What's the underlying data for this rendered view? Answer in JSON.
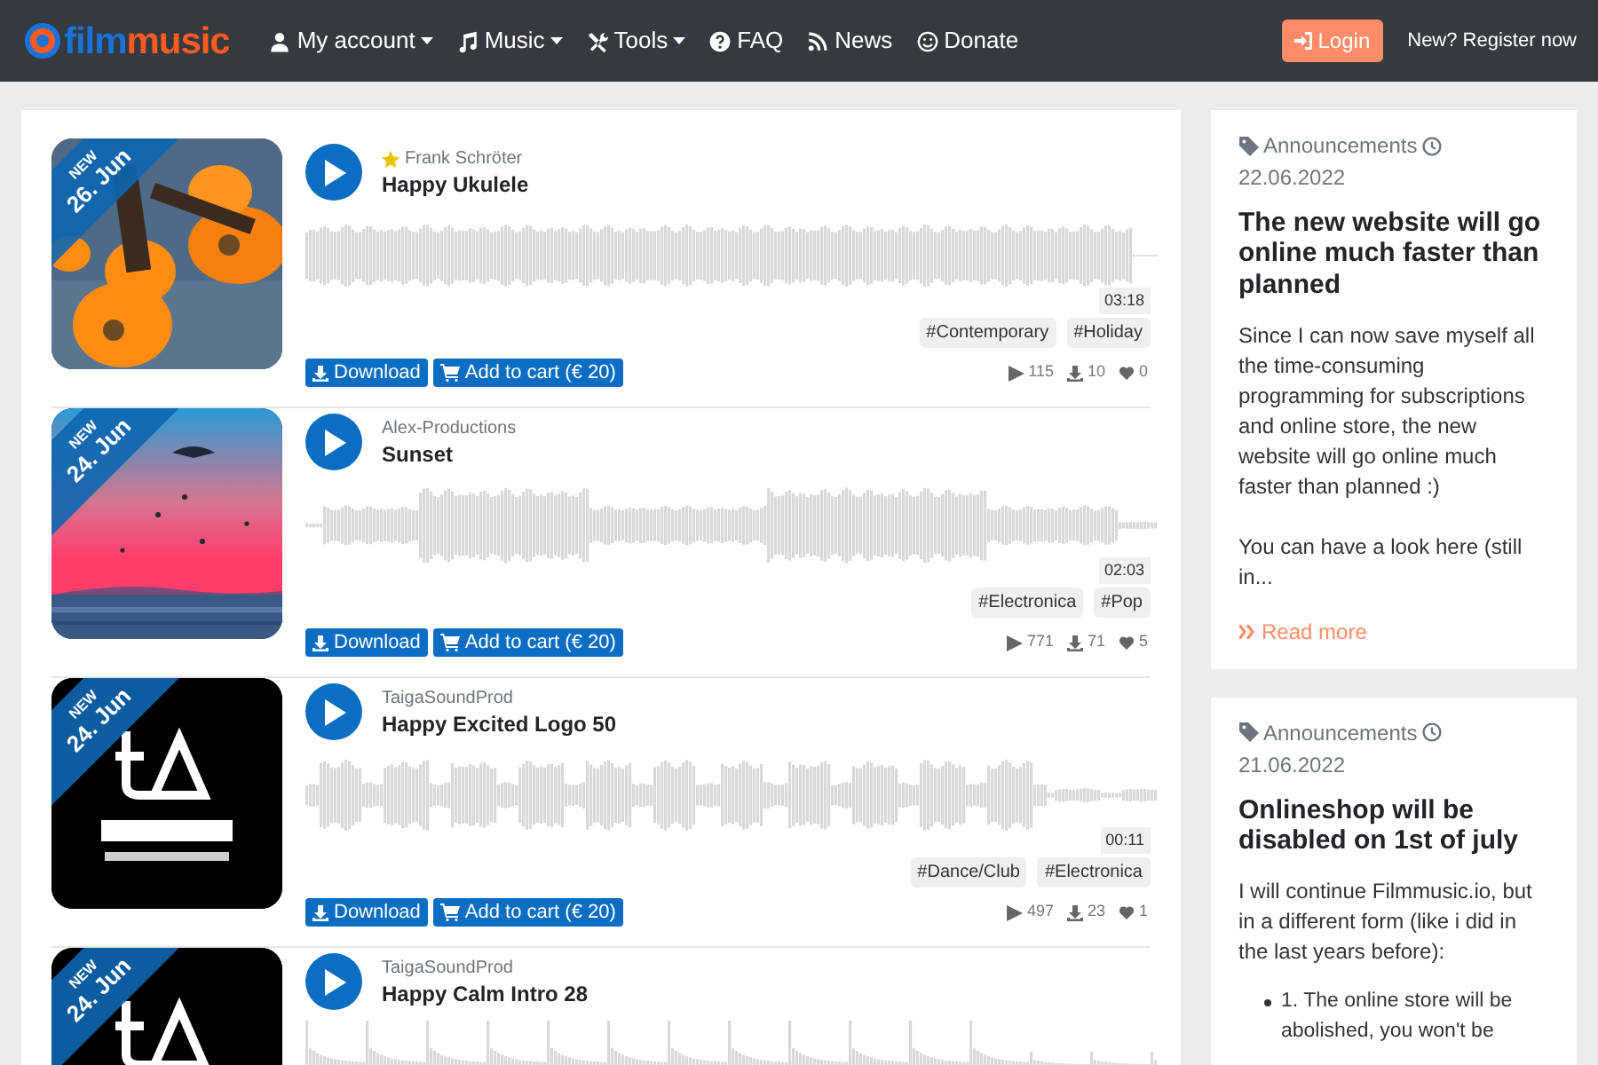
{
  "nav": {
    "logo": {
      "part_1": "film",
      "part_2": "music"
    },
    "items": [
      {
        "label": "My account",
        "dropdown": true
      },
      {
        "label": "Music",
        "dropdown": true
      },
      {
        "label": "Tools",
        "dropdown": true
      },
      {
        "label": "FAQ",
        "dropdown": false
      },
      {
        "label": "News",
        "dropdown": false
      },
      {
        "label": "Donate",
        "dropdown": false
      }
    ],
    "login": "Login",
    "register": "New? Register now"
  },
  "tracks": [
    {
      "badge_new": "NEW",
      "badge_date": "26. Jun",
      "artist": "Frank Schröter",
      "featured": true,
      "title": "Happy Ukulele",
      "duration": "03:18",
      "tags": [
        "#Contemporary",
        "#Holiday"
      ],
      "download": "Download",
      "cart": "Add to cart (€ 20)",
      "plays": "115",
      "downloads": "10",
      "likes": "0"
    },
    {
      "badge_new": "NEW",
      "badge_date": "24. Jun",
      "artist": "Alex-Productions",
      "featured": false,
      "title": "Sunset",
      "duration": "02:03",
      "tags": [
        "#Electronica",
        "#Pop"
      ],
      "download": "Download",
      "cart": "Add to cart (€ 20)",
      "plays": "771",
      "downloads": "71",
      "likes": "5"
    },
    {
      "badge_new": "NEW",
      "badge_date": "24. Jun",
      "artist": "TaigaSoundProd",
      "featured": false,
      "title": "Happy Excited Logo 50",
      "duration": "00:11",
      "tags": [
        "#Dance/Club",
        "#Electronica"
      ],
      "download": "Download",
      "cart": "Add to cart (€ 20)",
      "plays": "497",
      "downloads": "23",
      "likes": "1"
    },
    {
      "badge_new": "NEW",
      "badge_date": "24. Jun",
      "artist": "TaigaSoundProd",
      "featured": false,
      "title": "Happy Calm Intro 28"
    }
  ],
  "posts": [
    {
      "category": "Announcements",
      "date": "22.06.2022",
      "title": "The new website will go online much faster than planned",
      "paragraphs": [
        "Since I can now save myself all the time-consuming programming for subscriptions and online store, the new website will go online much faster than planned :)",
        "You can have a look here (still in..."
      ],
      "read_more": "Read more"
    },
    {
      "category": "Announcements",
      "date": "21.06.2022",
      "title": "Onlineshop will be disabled on 1st of july",
      "paragraphs": [
        "I will continue Filmmusic.io, but in a different form (like i did in the last years before):"
      ],
      "list": [
        "1. The online store will be abolished, you won't be"
      ]
    }
  ]
}
